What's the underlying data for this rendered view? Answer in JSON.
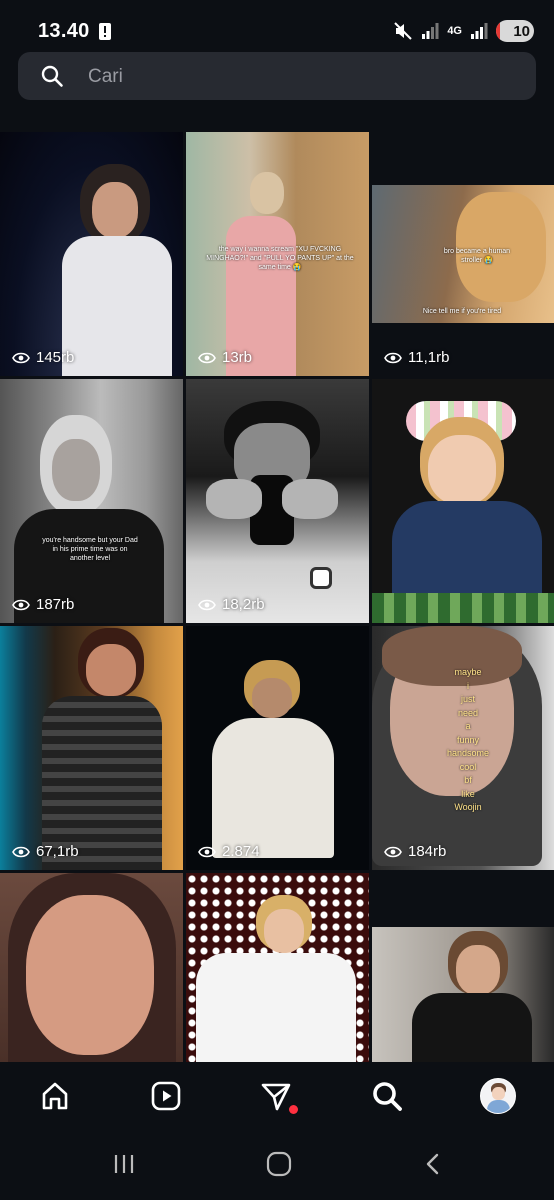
{
  "status": {
    "time": "13.40",
    "network": "4G",
    "battery": "10",
    "battery_level": 0.1,
    "icons": [
      "alert-icon",
      "mute-icon",
      "signal-icon",
      "4g-icon",
      "signal-icon",
      "battery-icon"
    ]
  },
  "search": {
    "placeholder": "Cari",
    "value": ""
  },
  "grid": {
    "tiles": [
      {
        "views": "145rb",
        "icon": "eye-icon"
      },
      {
        "views": "13rb",
        "icon": "eye-icon",
        "caption": "the way i wanna scream \"XU FVCKING MINGHAO?!\" and \"PULL YO PANTS UP\" at the same time 😭"
      },
      {
        "views": "11,1rb",
        "icon": "eye-icon",
        "caption_top": "bro became a human stroller 😭",
        "caption_bottom": "Nice tell me if you're tired"
      },
      {
        "views": "187rb",
        "icon": "eye-icon",
        "caption": "you're handsome but your Dad in his prime time was on another level"
      },
      {
        "views": "18,2rb",
        "icon": "eye-icon"
      },
      {
        "views": "",
        "icon": ""
      },
      {
        "views": "67,1rb",
        "icon": "eye-icon"
      },
      {
        "views": "2.874",
        "icon": "eye-icon"
      },
      {
        "views": "184rb",
        "icon": "eye-icon",
        "caption_words": [
          "maybe",
          "i",
          "just",
          "need",
          "a",
          "funny",
          "handsome",
          "cool",
          "bf",
          "like",
          "Woojin"
        ]
      },
      {
        "views": "",
        "icon": ""
      },
      {
        "views": "",
        "icon": ""
      },
      {
        "views": "",
        "icon": ""
      }
    ]
  },
  "bottom_nav": {
    "items": [
      "home-icon",
      "reels-icon",
      "send-icon",
      "search-icon",
      "profile-avatar"
    ],
    "active": "search-icon",
    "notification_color": "#ff3040"
  },
  "system_nav": {
    "items": [
      "recent-apps-icon",
      "home-button-icon",
      "back-icon"
    ]
  },
  "colors": {
    "background": "#0c0f14",
    "search_bg": "#272a31",
    "placeholder": "#9a9ca3"
  }
}
